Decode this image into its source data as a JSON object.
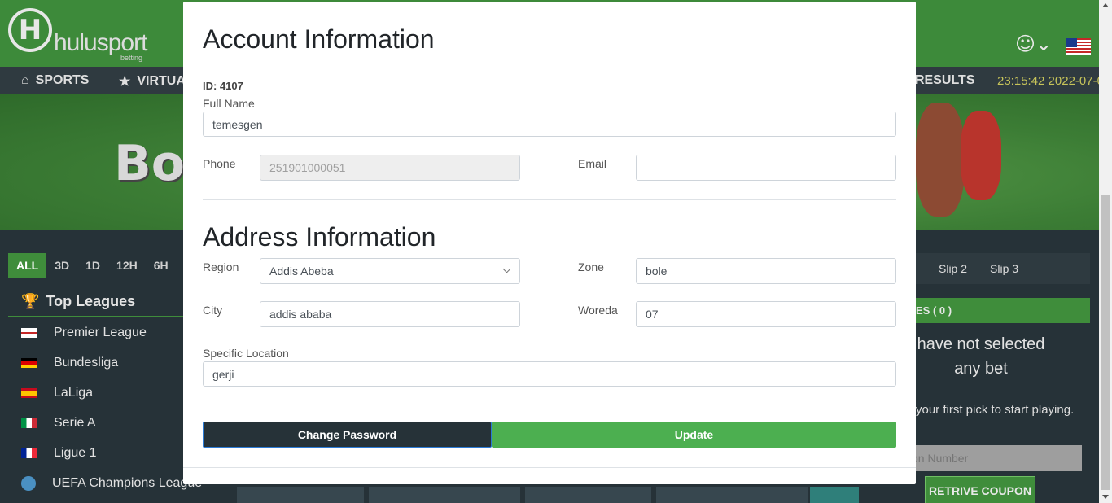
{
  "site": {
    "logo_letter": "H",
    "logo_text": "hulusport",
    "logo_sub": "betting",
    "nav": [
      {
        "label": "SPORTS",
        "icon": "home-icon"
      },
      {
        "label": "VIRTUA",
        "icon": "trophy-icon"
      },
      {
        "label": "RESULTS",
        "icon": ""
      }
    ],
    "datetime": "23:15:42 2022-07-0",
    "banner_text": "Bo",
    "filters": [
      "ALL",
      "3D",
      "1D",
      "12H",
      "6H"
    ],
    "leagues_title": "Top Leagues",
    "leagues": [
      {
        "name": "Premier League",
        "flag": "england"
      },
      {
        "name": "Bundesliga",
        "flag": "germany"
      },
      {
        "name": "LaLiga",
        "flag": "spain"
      },
      {
        "name": "Serie A",
        "flag": "italy"
      },
      {
        "name": "Ligue 1",
        "flag": "france"
      },
      {
        "name": "UEFA Champions League",
        "flag": "world"
      }
    ],
    "slip_tabs": [
      "Slip 2",
      "Slip 3"
    ],
    "slip_header": "ES ( 0 )",
    "slip_empty": "have not selected any bet",
    "slip_hint": "your first pick to start playing.",
    "coupon_placeholder": "on Number",
    "coupon_button": "RETRIVE COUPON"
  },
  "modal": {
    "title": "Account Information",
    "id_text": "ID: 4107",
    "full_name_label": "Full Name",
    "full_name_value": "temesgen",
    "phone_label": "Phone",
    "phone_value": "251901000051",
    "email_label": "Email",
    "email_value": "",
    "address_title": "Address Information",
    "region_label": "Region",
    "region_value": "Addis Abeba",
    "zone_label": "Zone",
    "zone_value": "bole",
    "city_label": "City",
    "city_value": "addis ababa",
    "woreda_label": "Woreda",
    "woreda_value": "07",
    "location_label": "Specific Location",
    "location_value": "gerji",
    "change_password_label": "Change Password",
    "update_label": "Update"
  },
  "colors": {
    "brand_green": "#3d8a3a",
    "button_green": "#4caf50",
    "dark_bg": "#263238"
  }
}
